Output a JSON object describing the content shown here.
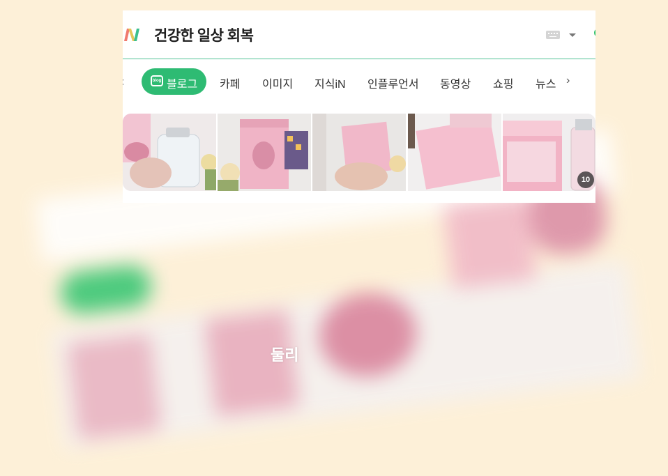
{
  "search": {
    "query": "건강한 일상 회복"
  },
  "tabs": {
    "items": [
      {
        "label": "블로그",
        "active": true
      },
      {
        "label": "카페"
      },
      {
        "label": "이미지"
      },
      {
        "label": "지식iN"
      },
      {
        "label": "인플루언서"
      },
      {
        "label": "동영상"
      },
      {
        "label": "쇼핑"
      },
      {
        "label": "뉴스"
      }
    ]
  },
  "blog_icon": {
    "text": "blog"
  },
  "thumbnails": {
    "more_count": "10"
  },
  "background": {
    "label": "둘리"
  },
  "colors": {
    "accent": "#2ebb73",
    "divider": "#4fc294",
    "page_bg": "#fdf0d8",
    "product_pink": "#f0b4c6"
  },
  "icons": [
    "naver-logo-icon",
    "keyboard-icon",
    "dropdown-caret-icon",
    "chevron-left-icon",
    "blog-icon",
    "chevron-right-icon"
  ]
}
